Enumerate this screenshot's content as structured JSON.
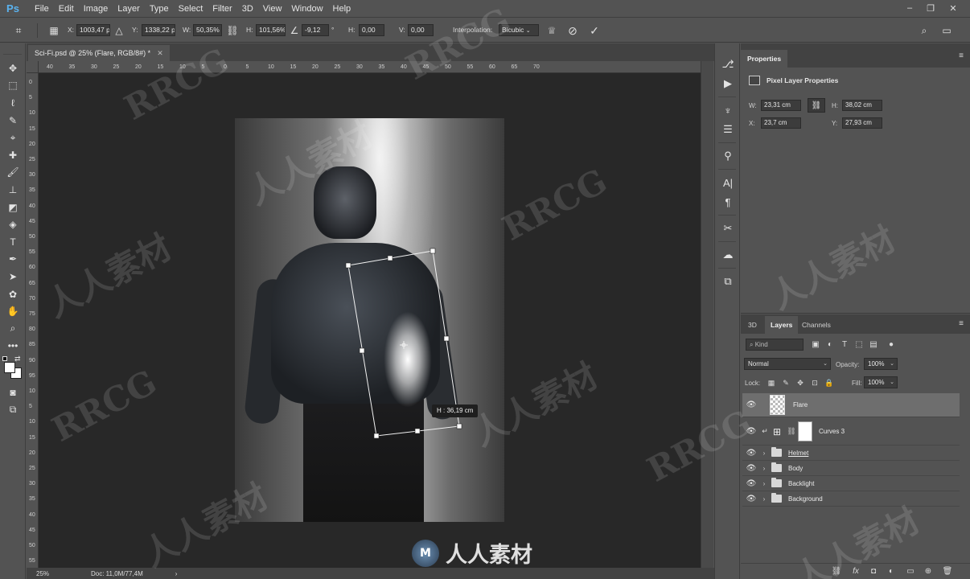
{
  "app": {
    "logo": "Ps"
  },
  "menu": [
    "File",
    "Edit",
    "Image",
    "Layer",
    "Type",
    "Select",
    "Filter",
    "3D",
    "View",
    "Window",
    "Help"
  ],
  "window_controls": {
    "minimize": "–",
    "restore": "❐",
    "close": "✕"
  },
  "options": {
    "x_label": "X:",
    "x_value": "1003,47 px",
    "y_label": "Y:",
    "y_value": "1338,22 px",
    "w_label": "W:",
    "w_value": "50,35%",
    "h_label": "H:",
    "h_value": "101,56%",
    "angle_value": "-9,12",
    "angle_unit": "°",
    "hskew_label": "H:",
    "hskew_value": "0,00",
    "vskew_label": "V:",
    "vskew_value": "0,00",
    "interp_label": "Interpolation:",
    "interp_value": "Bicubic",
    "cancel_icon": "cancel-icon",
    "commit_icon": "check-icon"
  },
  "document": {
    "tab_title": "Sci-Fi.psd @ 25% (Flare, RGB/8#) *",
    "zoom": "25%",
    "doc_info": "Doc: 11,0M/77,4M",
    "transform_readout": "H : 36,19 cm"
  },
  "ruler_h": [
    "40",
    "35",
    "30",
    "25",
    "20",
    "15",
    "10",
    "5",
    "0",
    "5",
    "10",
    "15",
    "20",
    "25",
    "30",
    "35",
    "40",
    "45",
    "50",
    "55",
    "60",
    "65",
    "70"
  ],
  "ruler_v": [
    "0",
    "5",
    "10",
    "15",
    "20",
    "25",
    "30",
    "35",
    "40",
    "45",
    "50",
    "55",
    "60",
    "65",
    "70",
    "75",
    "80",
    "85",
    "90",
    "95",
    "10",
    "5",
    "10",
    "15",
    "20",
    "25",
    "30",
    "35",
    "40",
    "45",
    "50",
    "55"
  ],
  "properties": {
    "tab": "Properties",
    "title": "Pixel Layer Properties",
    "w_label": "W:",
    "w_value": "23,31 cm",
    "h_label": "H:",
    "h_value": "38,02 cm",
    "x_label": "X:",
    "x_value": "23,7 cm",
    "y_label": "Y:",
    "y_value": "27,93 cm"
  },
  "layers_panel": {
    "tabs": [
      "3D",
      "Layers",
      "Channels"
    ],
    "kind_placeholder": "Kind",
    "blend_mode": "Normal",
    "opacity_label": "Opacity:",
    "opacity_value": "100%",
    "lock_label": "Lock:",
    "fill_label": "Fill:",
    "fill_value": "100%",
    "layers": [
      {
        "name": "Flare",
        "type": "pixel",
        "selected": true
      },
      {
        "name": "Curves 3",
        "type": "adjustment",
        "selected": false
      },
      {
        "name": "Helmet",
        "type": "group",
        "selected": false
      },
      {
        "name": "Body",
        "type": "group",
        "selected": false
      },
      {
        "name": "Backlight",
        "type": "group",
        "selected": false
      },
      {
        "name": "Background",
        "type": "group",
        "selected": false
      }
    ]
  },
  "watermarks": {
    "brand": "RRCG",
    "cn": "人人素材",
    "bottom_text": "人人素材"
  },
  "colors": {
    "panel": "#535353",
    "dark": "#424242",
    "canvas": "#282828",
    "ps_blue": "#5ab3f0"
  }
}
